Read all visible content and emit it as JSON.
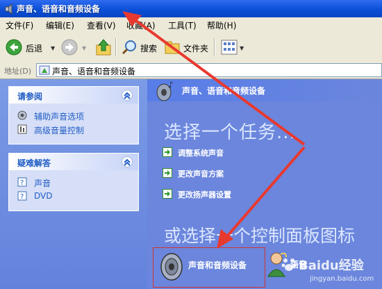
{
  "window": {
    "title": "声音、语音和音频设备"
  },
  "menu": [
    "文件(F)",
    "编辑(E)",
    "查看(V)",
    "收藏(A)",
    "工具(T)",
    "帮助(H)"
  ],
  "toolbar": {
    "back": "后退",
    "search": "搜索",
    "folders": "文件夹"
  },
  "address": {
    "label": "地址(D)",
    "value": "声音、语音和音频设备"
  },
  "see_also": {
    "title": "请参阅",
    "items": [
      "辅助声音选项",
      "高级音量控制"
    ]
  },
  "troubleshoot": {
    "title": "疑难解答",
    "items": [
      "声音",
      "DVD"
    ]
  },
  "main": {
    "header": "声音、语音和音频设备",
    "task_heading": "选择一个任务...",
    "tasks": [
      "调整系统声音",
      "更改声音方案",
      "更改扬声器设置"
    ],
    "or_heading": "或选择一个控制面板图标",
    "icons": [
      "声音和音频设备",
      "语音"
    ]
  },
  "watermark": {
    "brand": "Baidu经验",
    "url": "jingyan.baidu.com"
  },
  "colors": {
    "title_bar": "#0a4fd6",
    "link": "#215dc6",
    "arrow": "#e8392f",
    "pane_bg": "#6b86dc"
  }
}
